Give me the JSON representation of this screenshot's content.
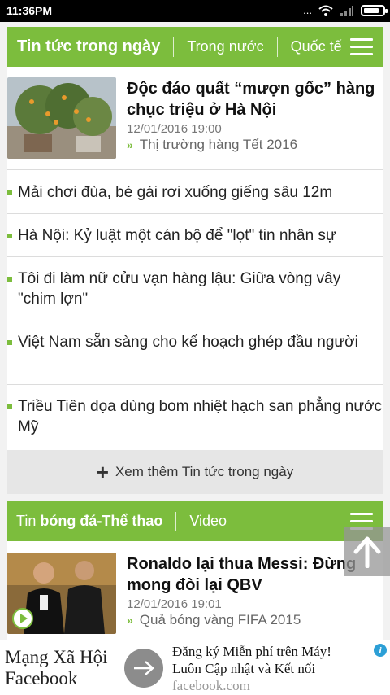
{
  "status": {
    "time": "11:36PM",
    "dots": "...",
    "battery_percent": 80
  },
  "section1": {
    "title": "Tin tức trong ngày",
    "tabs": [
      "Trong nước",
      "Quốc tế"
    ],
    "featured": {
      "title": "Độc đáo quất “mượn gốc” hàng chục triệu ở Hà Nội",
      "date": "12/01/2016 19:00",
      "tag": "Thị trường hàng Tết 2016"
    },
    "items": [
      "Mải chơi đùa, bé gái rơi xuống giếng sâu 12m",
      "Hà Nội: Kỷ luật một cán bộ để \"lọt\" tin nhân sự",
      "Tôi đi làm nữ cửu vạn hàng lậu: Giữa vòng vây \"chim lợn\"",
      "Việt Nam sẵn sàng cho kế hoạch ghép đầu người",
      "Triều Tiên dọa dùng bom nhiệt hạch san phẳng nước Mỹ"
    ],
    "more": "Xem thêm Tin tức trong ngày"
  },
  "section2": {
    "title_prefix": "Tin ",
    "title_bold": "bóng đá-Thể thao",
    "tab": "Video",
    "featured": {
      "title": "Ronaldo lại thua Messi: Đừng mong đòi lại QBV",
      "date": "12/01/2016 19:01",
      "tag": "Quả bóng vàng FIFA 2015"
    }
  },
  "ad": {
    "left_line1": "Mạng Xã Hội",
    "left_line2": "Facebook",
    "right_line1": "Đăng ký Miễn phí trên Máy!",
    "right_line2": "Luôn Cập nhật và Kết nối",
    "right_line3": "facebook.com",
    "info": "i"
  },
  "colors": {
    "accent": "#7cbd3d"
  }
}
